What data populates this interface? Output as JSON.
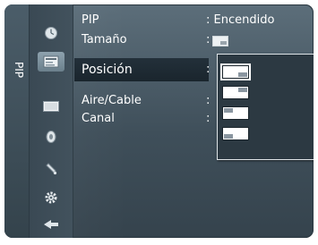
{
  "side_label": "PIP",
  "icons": [
    "clock-icon",
    "tv-guide-icon",
    "picture-icon",
    "sound-icon",
    "channel-icon",
    "setup-icon",
    "input-icon"
  ],
  "menu": {
    "rows": [
      {
        "label": "PIP",
        "value": ": Encendido"
      },
      {
        "label": "Tamaño",
        "value": ":"
      },
      {
        "label": "Posición",
        "value": ":"
      },
      {
        "label": "Aire/Cable",
        "value": ":"
      },
      {
        "label": "Canal",
        "value": ":"
      }
    ]
  },
  "dropdown": {
    "options": [
      "bottom-right",
      "top-right",
      "top-left",
      "bottom-left"
    ],
    "selected": "bottom-right"
  },
  "colors": {
    "menu_bg": "#4a5b66",
    "selection_bg": "#1f2b33",
    "dropdown_border": "#dfe5e8"
  }
}
